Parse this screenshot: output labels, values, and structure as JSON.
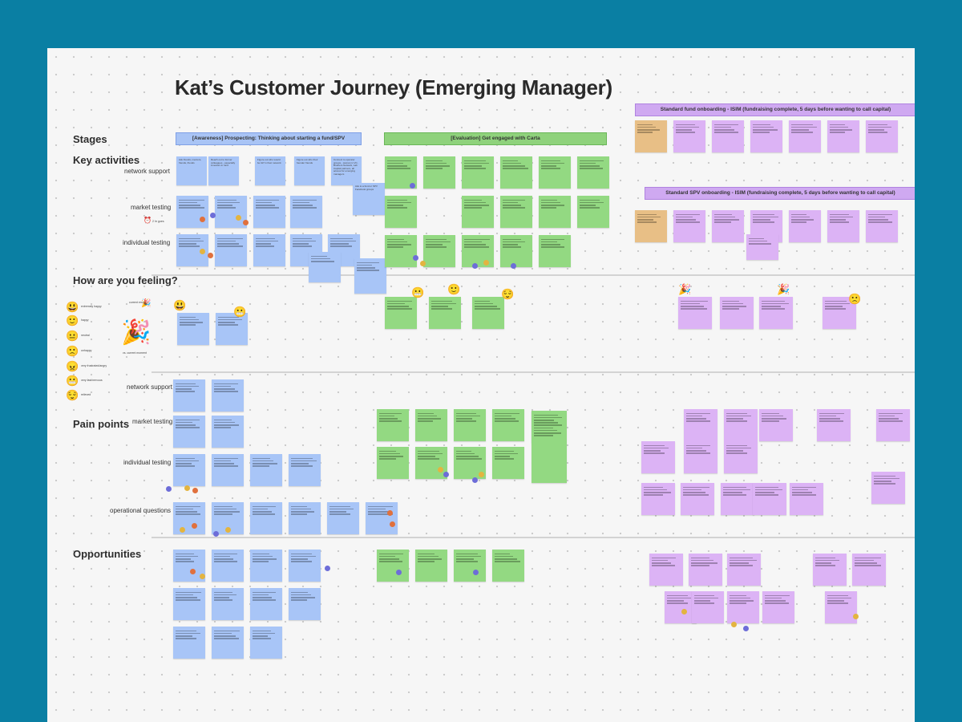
{
  "board": {
    "title": "Kat’s Customer Journey (Emerging Manager)",
    "colors": {
      "background": "#0a7fa3",
      "canvas": "#f6f6f6",
      "blue": "#a8c5f7",
      "green": "#93d982",
      "purple": "#dcb3f5",
      "orange": "#e8bf86"
    }
  },
  "sections": {
    "stages": "Stages",
    "key_activities": "Key activities",
    "feeling": "How are you feeling?",
    "pain_points": "Pain points",
    "opportunities": "Opportunities"
  },
  "sublabels": {
    "ka_network": "network support",
    "ka_market": "market testing",
    "ka_individual": "individual testing",
    "pp_network": "network support",
    "pp_market": "market testing",
    "pp_individual": "individual testing",
    "pp_operational": "operational questions"
  },
  "banners": {
    "awareness": "[Awareness] Prospecting: Thinking about starting a fund/SPV",
    "evaluation": "[Evaluation] Get engaged with Carta",
    "fund_onboarding": "Standard fund onboarding - ISIM (fundraising complete, 5 days before wanting to call capital)",
    "spv_onboarding": "Standard SPV onboarding - ISIM (fundraising complete, 5 days before wanting to call capital)"
  },
  "legend": {
    "items": [
      "extremely happy",
      "happy",
      "neutral",
      "unhappy",
      "very frustrated/angry",
      "very fast/nervous",
      "relieved"
    ],
    "current_emotion": "current emotion",
    "vs_current": "vs. current moment",
    "timer": "2 hr goes"
  },
  "notes": {
    "stage_awareness": [
      "Ask friends, mentors, friends, friends",
      "Reach out to former colleagues - especially investors in fund",
      "Figure out who would be GP in their network",
      "Figure out who their founder friends",
      "Connect to operator groups - woman in VC, Brothers Network, Lab Capital partners, all access for emerging managers",
      "Ask to a fund or SPV Facebook groups"
    ]
  }
}
